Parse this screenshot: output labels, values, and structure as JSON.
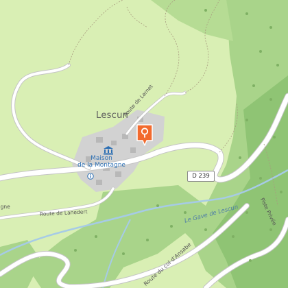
{
  "map": {
    "town": "Lescun",
    "poi": {
      "name_line1": "Maison",
      "name_line2": "de la Montagne"
    },
    "road_shield": "D 239",
    "roads": {
      "larnet": "Route de Larnet",
      "lanedert": "Route de Lanedert",
      "ansabe": "Route du col d'Ansabe",
      "piste": "Piste Privée",
      "left_edge": "agne"
    },
    "river": "Le Gave de Lescun",
    "marker_icon": "map-pin-icon",
    "poi_icon": "museum-icon",
    "info_icon": "info-circle-icon"
  },
  "colors": {
    "meadow": "#d9efb4",
    "forest": "#a9d48a",
    "forest_dark": "#8fc474",
    "road": "#ffffff",
    "water": "#a6cbe6",
    "village": "#c9c9c9",
    "marker": "#f26a2e",
    "poi_blue": "#2c6fb3"
  }
}
